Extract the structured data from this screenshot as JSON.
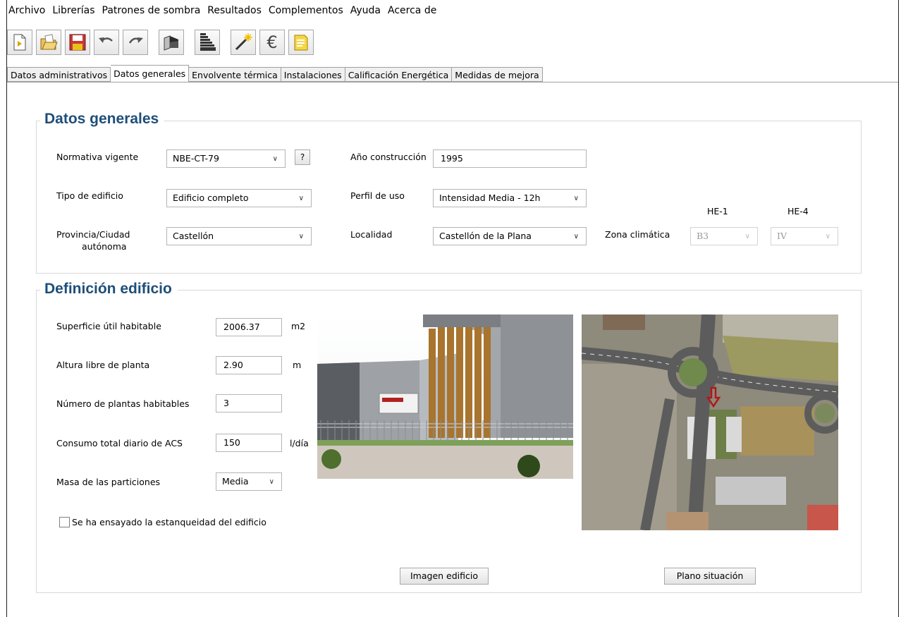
{
  "menu": [
    "Archivo",
    "Librerías",
    "Patrones de sombra",
    "Resultados",
    "Complementos",
    "Ayuda",
    "Acerca de"
  ],
  "toolbar": {
    "icons": [
      "new-file-icon",
      "open-folder-icon",
      "save-icon",
      "undo-icon",
      "redo-icon",
      "building-3d-icon",
      "energy-rating-icon",
      "magic-wand-icon",
      "euro-icon",
      "report-icon"
    ],
    "euro_symbol": "€"
  },
  "tabs": [
    "Datos administrativos",
    "Datos generales",
    "Envolvente térmica",
    "Instalaciones",
    "Calificación Energética",
    "Medidas de mejora"
  ],
  "active_tab": "Datos generales",
  "datos_generales": {
    "title": "Datos generales",
    "normativa_label": "Normativa vigente",
    "normativa_value": "NBE-CT-79",
    "help_label": "?",
    "anio_label": "Año construcción",
    "anio_value": "1995",
    "tipo_label": "Tipo de edificio",
    "tipo_value": "Edificio completo",
    "perfil_label": "Perfil de uso",
    "perfil_value": "Intensidad Media - 12h",
    "provincia_label_1": "Provincia/Ciudad",
    "provincia_label_2": "autónoma",
    "provincia_value": "Castellón",
    "localidad_label": "Localidad",
    "localidad_value": "Castellón de la Plana",
    "zona_label": "Zona climática",
    "he1_label": "HE-1",
    "he4_label": "HE-4",
    "he1_value": "B3",
    "he4_value": "IV"
  },
  "definicion": {
    "title": "Definición edificio",
    "superficie_label": "Superficie útil habitable",
    "superficie_value": "2006.37",
    "superficie_unit": "m2",
    "altura_label": "Altura libre de planta",
    "altura_value": "2.90",
    "altura_unit": "m",
    "plantas_label": "Número de plantas habitables",
    "plantas_value": "3",
    "acs_label": "Consumo total diario de ACS",
    "acs_value": "150",
    "acs_unit": "l/día",
    "masa_label": "Masa de las particiones",
    "masa_value": "Media",
    "estanqueidad_label": "Se ha ensayado la estanqueidad del edificio",
    "estanqueidad_checked": false,
    "imagen_button": "Imagen edificio",
    "plano_button": "Plano situación"
  },
  "chevron": "∨"
}
